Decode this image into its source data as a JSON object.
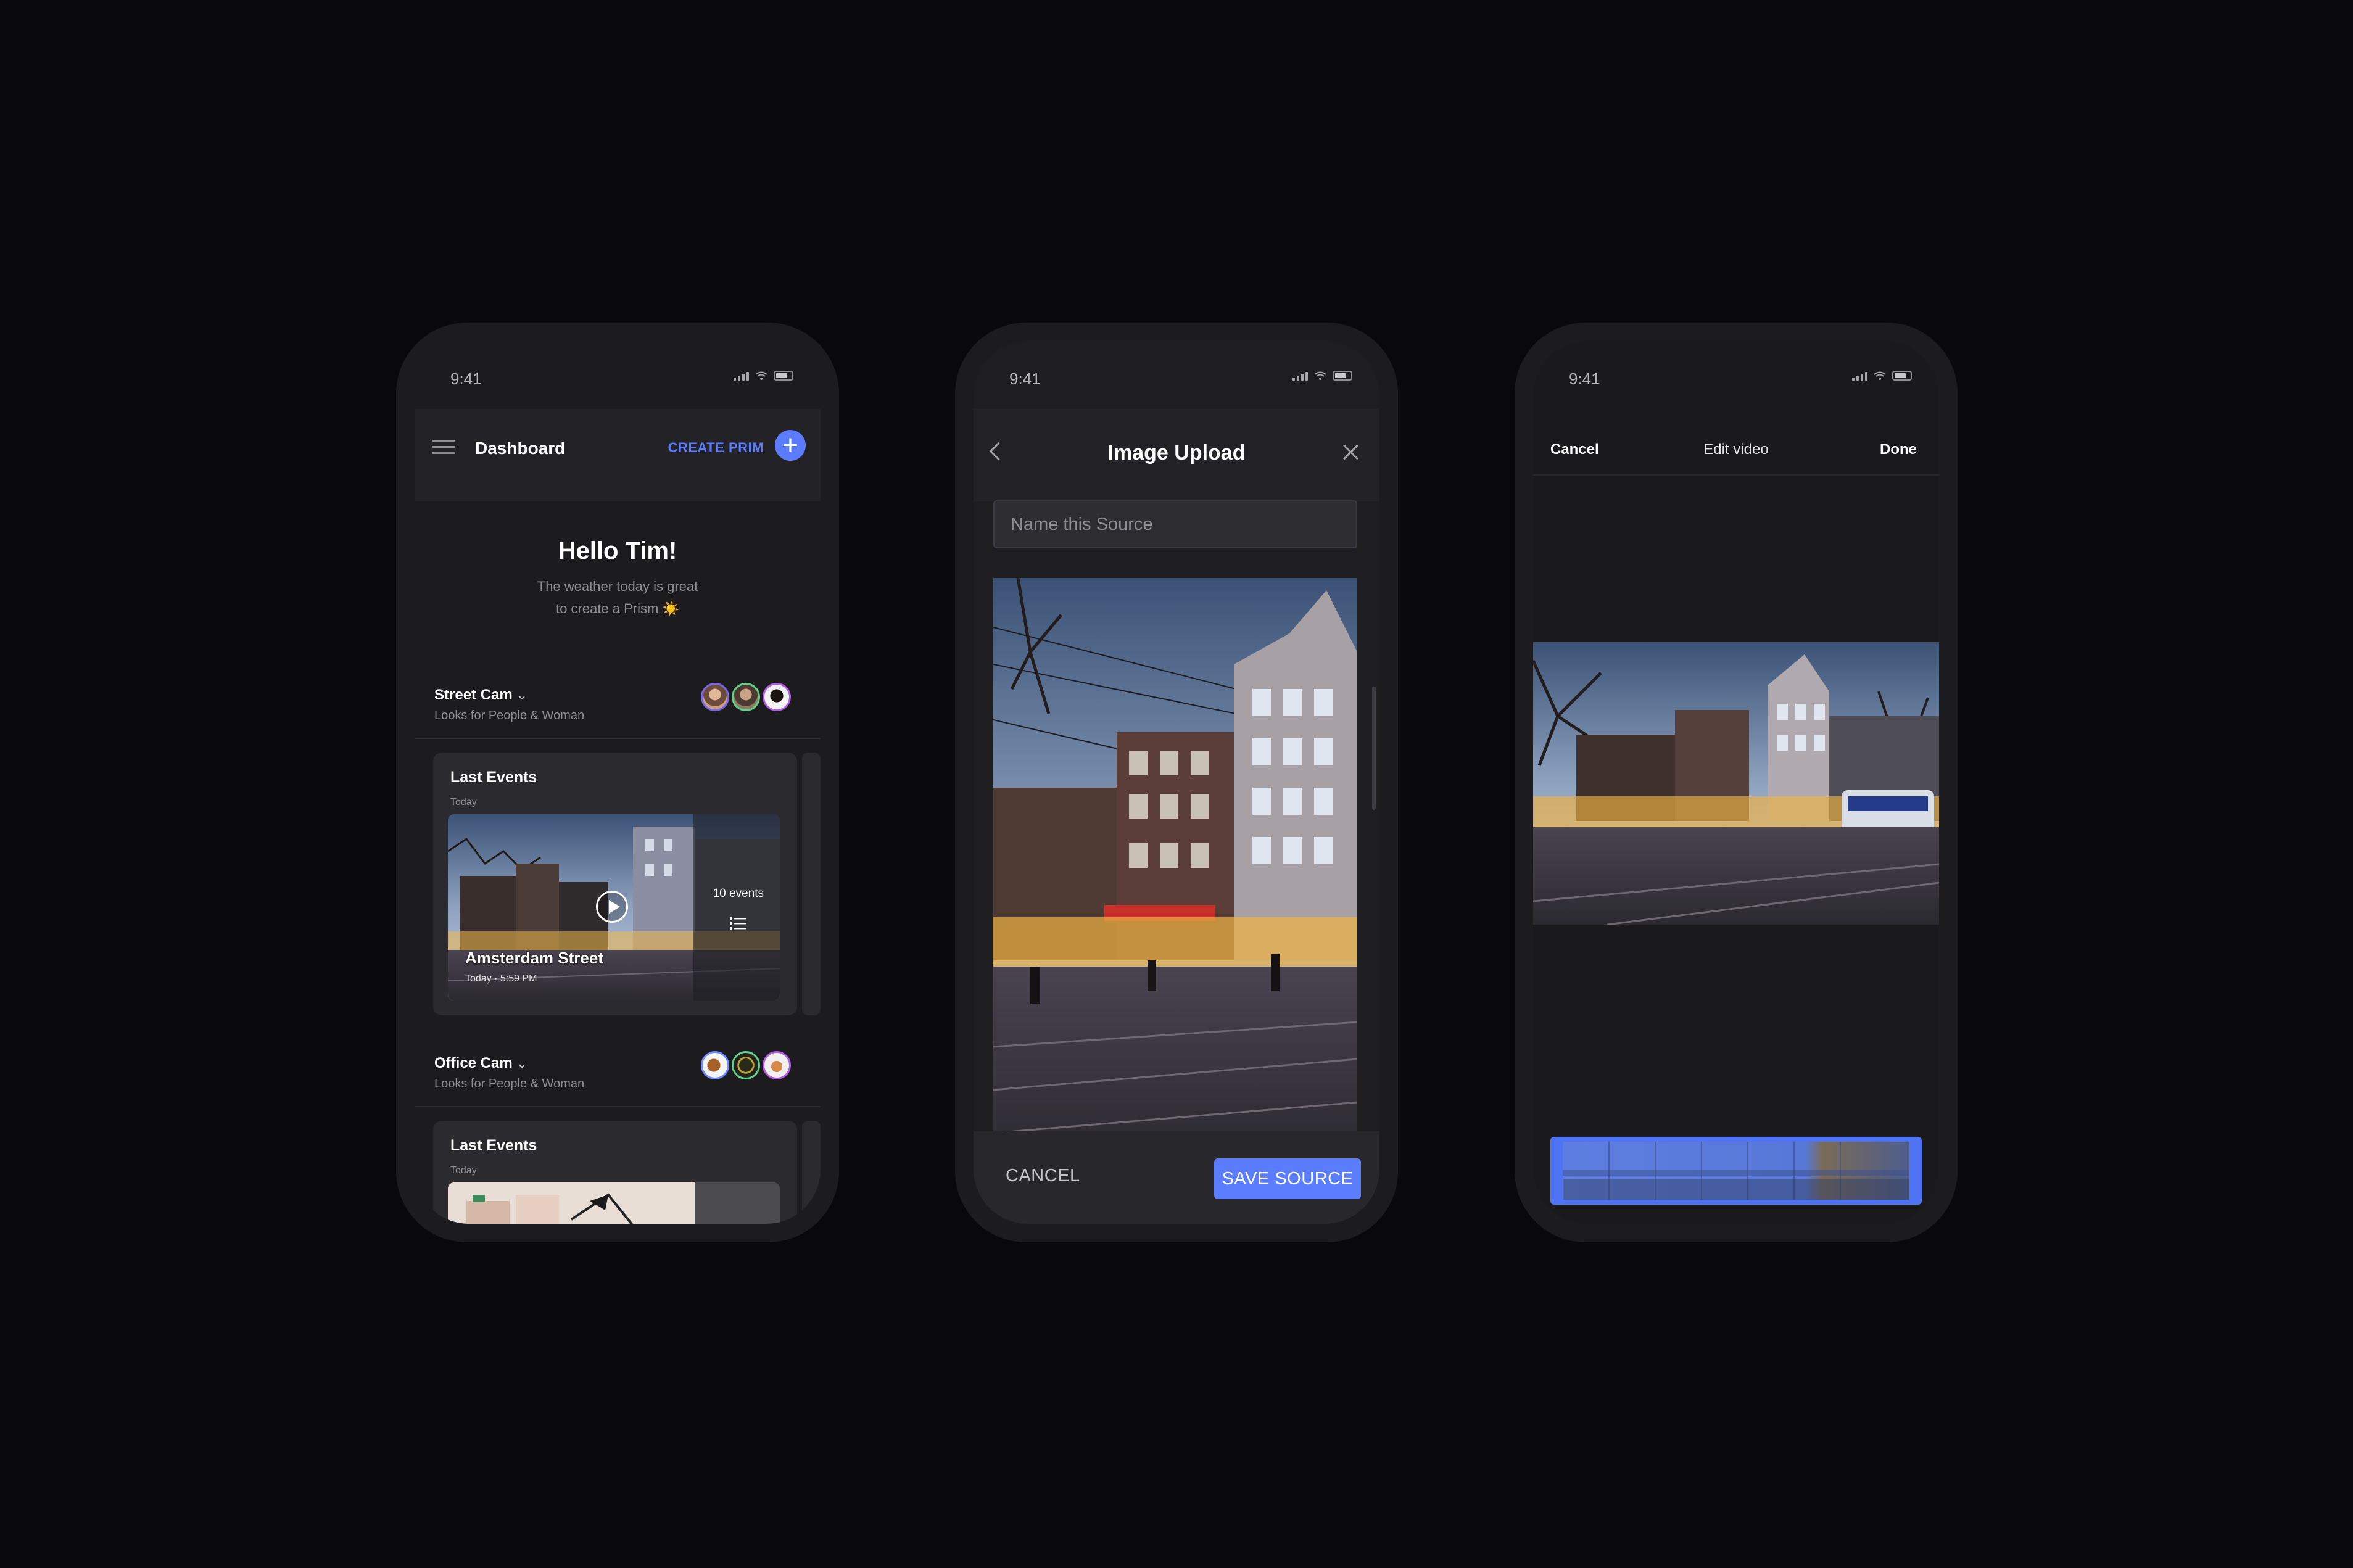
{
  "status_time": "9:41",
  "dashboard": {
    "title": "Dashboard",
    "create_label": "CREATE PRIM",
    "greeting": "Hello Tim!",
    "weather_line1": "The weather today is great",
    "weather_line2": "to create a Prism ☀️",
    "cams": [
      {
        "name": "Street Cam",
        "subtitle": "Looks for People & Woman",
        "card": {
          "title": "Last Events",
          "date": "Today",
          "thumb_title": "Amsterdam Street",
          "thumb_time": "Today · 5:59 PM",
          "events_count": "10 events"
        }
      },
      {
        "name": "Office Cam",
        "subtitle": "Looks for People & Woman",
        "card": {
          "title": "Last Events",
          "date": "Today"
        }
      }
    ]
  },
  "upload": {
    "title": "Image Upload",
    "input_placeholder": "Name this Source",
    "input_value": "",
    "cancel_label": "CANCEL",
    "save_label": "SAVE SOURCE"
  },
  "edit_video": {
    "cancel_label": "Cancel",
    "title": "Edit video",
    "done_label": "Done"
  },
  "colors": {
    "accent": "#5b7cff",
    "background": "#09090b",
    "phone": "#1c1c1f"
  }
}
